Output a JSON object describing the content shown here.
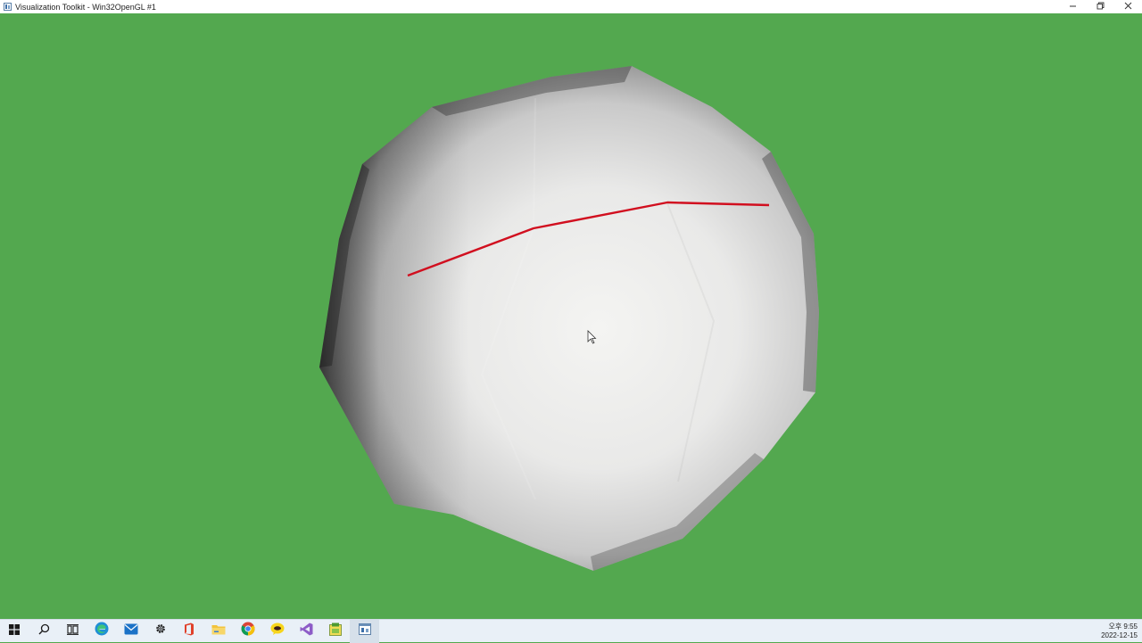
{
  "window": {
    "title": "Visualization Toolkit - Win32OpenGL #1",
    "minimize_icon": "minimize-icon",
    "restore_icon": "restore-icon",
    "close_icon": "close-icon"
  },
  "scene": {
    "background_color": "#53a84f",
    "object": "shaded-sphere",
    "polyline_color": "#d10f1f",
    "cursor": "mouse-cursor-icon"
  },
  "taskbar": {
    "items": [
      {
        "icon": "windows-start-icon"
      },
      {
        "icon": "search-icon"
      },
      {
        "icon": "task-view-icon"
      },
      {
        "icon": "edge-browser-icon"
      },
      {
        "icon": "mail-icon"
      },
      {
        "icon": "settings-gear-icon"
      },
      {
        "icon": "office-icon"
      },
      {
        "icon": "file-explorer-icon"
      },
      {
        "icon": "chrome-icon"
      },
      {
        "icon": "kakaotalk-icon"
      },
      {
        "icon": "visual-studio-icon"
      },
      {
        "icon": "app-icon"
      },
      {
        "icon": "vtk-window-icon"
      }
    ],
    "clock": {
      "time": "오후 9:55",
      "date": "2022-12-15"
    }
  }
}
